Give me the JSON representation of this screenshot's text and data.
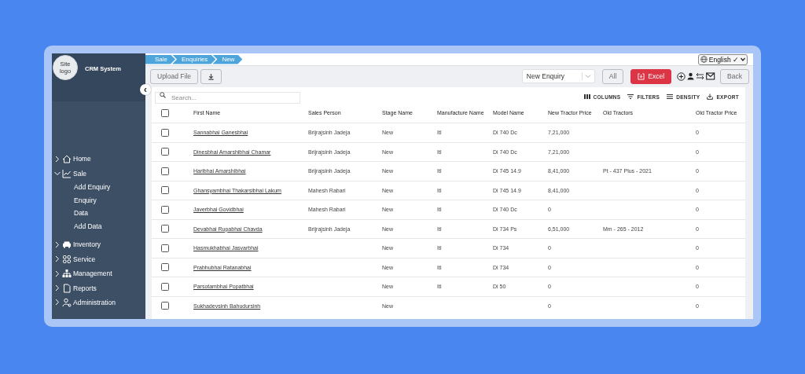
{
  "sidebar": {
    "logo_alt": "Site logo",
    "title": "CRM System",
    "collapse_button": "‹",
    "items": [
      {
        "label": "Home",
        "expanded": false
      },
      {
        "label": "Sale",
        "expanded": true,
        "children": [
          {
            "label": "Add Enquiry"
          },
          {
            "label": "Enquiry"
          },
          {
            "label": "Data"
          },
          {
            "label": "Add Data"
          }
        ]
      },
      {
        "label": "Inventory",
        "expanded": false
      },
      {
        "label": "Service",
        "expanded": false
      },
      {
        "label": "Management",
        "expanded": false
      },
      {
        "label": "Reports",
        "expanded": false
      },
      {
        "label": "Administration",
        "expanded": false
      }
    ]
  },
  "breadcrumbs": [
    "Sale",
    "Enquiries",
    "New"
  ],
  "language": {
    "value": "English ✓"
  },
  "toolbar": {
    "upload_button": "Upload File",
    "enquiry_select": {
      "value": "New Enquiry"
    },
    "all_button": "All",
    "excel_button": "Excel",
    "back_button": "Back"
  },
  "search": {
    "placeholder": "Search..."
  },
  "grid_actions": [
    "COLUMNS",
    "FILTERS",
    "DENSITY",
    "EXPORT"
  ],
  "table": {
    "select_all": {
      "checked": false
    },
    "columns": [
      "First Name",
      "Sales Person",
      "Stage Name",
      "Manufacture Name",
      "Model Name",
      "New Tractor Price",
      "Old Tractors",
      "Old Tractor Price"
    ],
    "rows": [
      {
        "checked": false,
        "first_name": "Sannabhai Ganesbhai",
        "sales_person": "Brijrajsinh Jadeja",
        "stage": "New",
        "manufacturer": "Itl",
        "model": "Di 740 Dc",
        "new_price": "7,21,000",
        "old_price": "0"
      },
      {
        "checked": false,
        "first_name": "Dinesbhai Amarshibhai Chamar",
        "sales_person": "Brijrajsinh Jadeja",
        "stage": "New",
        "manufacturer": "Itl",
        "model": "Di 740 Dc",
        "new_price": "7,21,000",
        "old_price": "0"
      },
      {
        "checked": false,
        "first_name": "Haribhai Amarshibhai",
        "sales_person": "Brijrajsinh Jadeja",
        "stage": "New",
        "manufacturer": "Itl",
        "model": "Di 745 14.9",
        "new_price": "8,41,000",
        "old_tractors": "Pt - 437 Plus - 2021",
        "old_price": "0"
      },
      {
        "checked": false,
        "first_name": "Ghansyambhai Thakarsibhai Lakum",
        "sales_person": "Mahesh Rabari",
        "stage": "New",
        "manufacturer": "Itl",
        "model": "Di 745 14.9",
        "new_price": "8,41,000",
        "old_price": "0"
      },
      {
        "checked": false,
        "first_name": "Javerbhai Govidbhai",
        "sales_person": "Mahesh Rabari",
        "stage": "New",
        "manufacturer": "Itl",
        "model": "Di 740 Dc",
        "new_price": "0",
        "old_price": "0"
      },
      {
        "checked": false,
        "first_name": "Devabhai Rupabhai Chavda",
        "sales_person": "Brijrajsinh Jadeja",
        "stage": "New",
        "manufacturer": "Itl",
        "model": "Di 734 Ps",
        "new_price": "6,51,000",
        "old_tractors": "Mm - 265 - 2012",
        "old_price": "0"
      },
      {
        "checked": false,
        "first_name": "Hasmukhabhai Jasvarbhai",
        "stage": "New",
        "manufacturer": "Itl",
        "model": "Di 734",
        "new_price": "0",
        "old_price": "0"
      },
      {
        "checked": false,
        "first_name": "Prabhubhai Ratanabhai",
        "stage": "New",
        "manufacturer": "Itl",
        "model": "Di 734",
        "new_price": "0",
        "old_price": "0"
      },
      {
        "checked": false,
        "first_name": "Parsotambhai Popatbhai",
        "stage": "New",
        "manufacturer": "Itl",
        "model": "Di 50",
        "new_price": "0",
        "old_price": "0"
      },
      {
        "checked": false,
        "first_name": "Sukhadevsinh Bahudursinh",
        "stage": "New",
        "new_price": "0",
        "old_price": "0"
      }
    ]
  }
}
